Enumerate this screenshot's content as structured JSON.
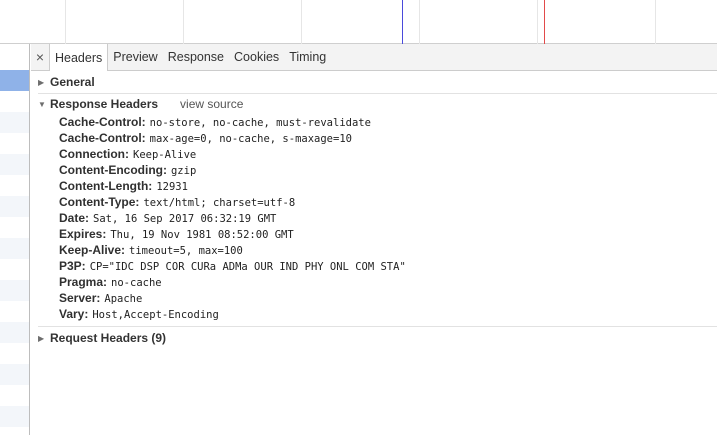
{
  "tabs": {
    "close": "×",
    "items": [
      "Headers",
      "Preview",
      "Response",
      "Cookies",
      "Timing"
    ],
    "active": "Headers"
  },
  "sections": {
    "general": {
      "title": "General",
      "expanded": false
    },
    "response": {
      "title": "Response Headers",
      "expanded": true,
      "view_source": "view source",
      "headers": [
        {
          "name": "Cache-Control:",
          "value": "no-store, no-cache, must-revalidate"
        },
        {
          "name": "Cache-Control:",
          "value": "max-age=0, no-cache, s-maxage=10"
        },
        {
          "name": "Connection:",
          "value": "Keep-Alive"
        },
        {
          "name": "Content-Encoding:",
          "value": "gzip"
        },
        {
          "name": "Content-Length:",
          "value": "12931"
        },
        {
          "name": "Content-Type:",
          "value": "text/html; charset=utf-8"
        },
        {
          "name": "Date:",
          "value": "Sat, 16 Sep 2017 06:32:19 GMT"
        },
        {
          "name": "Expires:",
          "value": "Thu, 19 Nov 1981 08:52:00 GMT"
        },
        {
          "name": "Keep-Alive:",
          "value": "timeout=5, max=100"
        },
        {
          "name": "P3P:",
          "value": "CP=\"IDC DSP COR CURa ADMa OUR IND PHY ONL COM STA\""
        },
        {
          "name": "Pragma:",
          "value": "no-cache"
        },
        {
          "name": "Server:",
          "value": "Apache"
        },
        {
          "name": "Vary:",
          "value": "Host,Accept-Encoding"
        }
      ]
    },
    "request": {
      "title": "Request Headers (9)",
      "expanded": false
    }
  },
  "colors": {
    "timeline_marker_blue": "#4a4adb",
    "timeline_marker_red": "#e24a4a",
    "selected_row": "#8fb2e8"
  },
  "icons": {
    "collapsed": "▶",
    "expanded": "▼"
  }
}
